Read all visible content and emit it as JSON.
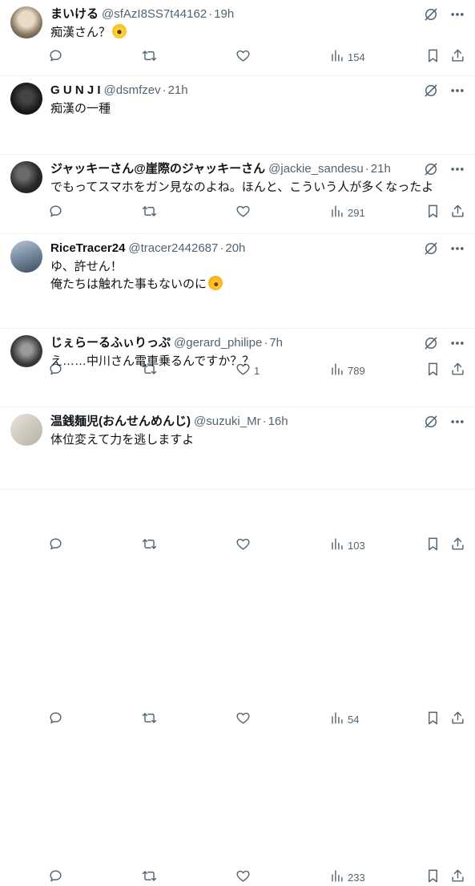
{
  "tweets": [
    {
      "name": "まいける",
      "handle": "@sfAzI8SS7t44162",
      "sep": "·",
      "time": "19h",
      "lines": [
        "痴漢さん？"
      ],
      "emoji_after_line": 0,
      "emoji": "screaming-face",
      "replies": "",
      "retweets": "",
      "likes": "",
      "views": "154"
    },
    {
      "name": "G U N J I",
      "handle": "@dsmfzev",
      "sep": "·",
      "time": "21h",
      "lines": [
        "痴漢の一種"
      ],
      "emoji_after_line": -1,
      "emoji": "",
      "replies": "",
      "retweets": "",
      "likes": "",
      "views": "291"
    },
    {
      "name": "ジャッキーさん@崖際のジャッキーさん",
      "handle": "@jackie_sandesu",
      "sep": "·",
      "time": "21h",
      "lines": [
        "でもってスマホをガン見なのよね。ほんと、こういう人が多くなったよ"
      ],
      "emoji_after_line": -1,
      "emoji": "",
      "replies": "",
      "retweets": "",
      "likes": "1",
      "views": "789"
    },
    {
      "name": "RiceTracer24",
      "handle": "@tracer2442687",
      "sep": "·",
      "time": "20h",
      "lines": [
        "ゆ、許せん！",
        "俺たちは触れた事もないのに"
      ],
      "emoji_after_line": 1,
      "emoji": "rolling-on-floor-laughing",
      "replies": "",
      "retweets": "",
      "likes": "",
      "views": "103"
    },
    {
      "name": "じぇらーるふぃりっぷ",
      "handle": "@gerard_philipe",
      "sep": "·",
      "time": "7h",
      "lines": [
        "え……中川さん電車乗るんですか？？"
      ],
      "emoji_after_line": -1,
      "emoji": "",
      "replies": "",
      "retweets": "",
      "likes": "",
      "views": "54"
    },
    {
      "name": "温銭麺児(おんせんめんじ)",
      "handle": "@suzuki_Mr",
      "sep": "·",
      "time": "16h",
      "lines": [
        "体位変えて力を逃しますよ"
      ],
      "emoji_after_line": -1,
      "emoji": "",
      "replies": "",
      "retweets": "",
      "likes": "",
      "views": "233"
    }
  ],
  "icons": {
    "reply": "reply-icon",
    "retweet": "retweet-icon",
    "like": "heart-icon",
    "views": "views-icon",
    "bookmark": "bookmark-icon",
    "share": "share-icon",
    "grok": "grok-icon",
    "more": "more-icon"
  },
  "colors": {
    "text": "#0f1419",
    "secondary": "#536471",
    "divider": "#eff3f4"
  }
}
